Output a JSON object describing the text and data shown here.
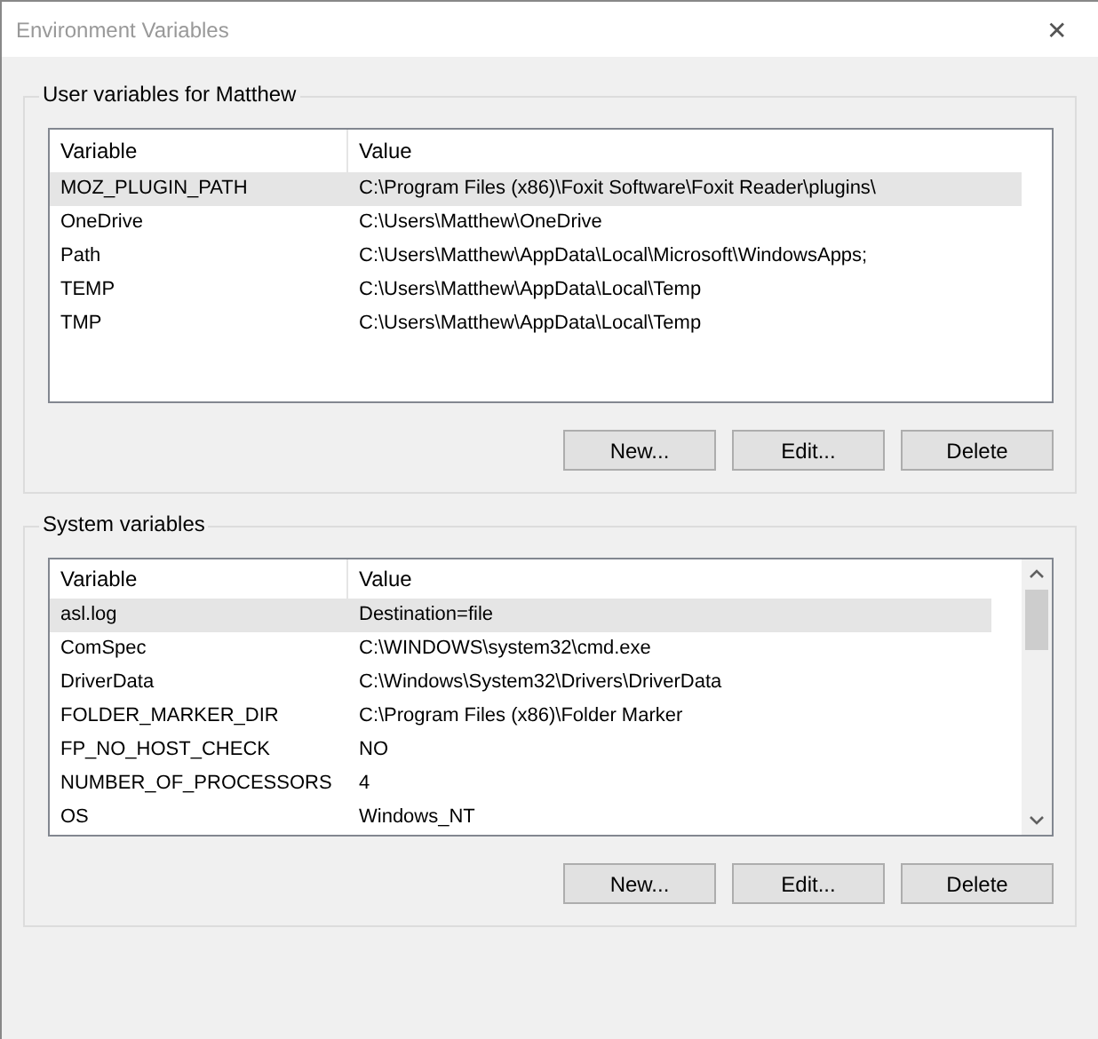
{
  "window": {
    "title": "Environment Variables",
    "close": "✕"
  },
  "groups": [
    {
      "title": "User variables for Matthew",
      "scrollable": false,
      "columns": [
        "Variable",
        "Value"
      ],
      "rows": [
        {
          "variable": "MOZ_PLUGIN_PATH",
          "value": "C:\\Program Files (x86)\\Foxit Software\\Foxit Reader\\plugins\\",
          "selected": true
        },
        {
          "variable": "OneDrive",
          "value": "C:\\Users\\Matthew\\OneDrive",
          "selected": false
        },
        {
          "variable": "Path",
          "value": "C:\\Users\\Matthew\\AppData\\Local\\Microsoft\\WindowsApps;",
          "selected": false
        },
        {
          "variable": "TEMP",
          "value": "C:\\Users\\Matthew\\AppData\\Local\\Temp",
          "selected": false
        },
        {
          "variable": "TMP",
          "value": "C:\\Users\\Matthew\\AppData\\Local\\Temp",
          "selected": false
        }
      ],
      "buttons": [
        "New...",
        "Edit...",
        "Delete"
      ]
    },
    {
      "title": "System variables",
      "scrollable": true,
      "columns": [
        "Variable",
        "Value"
      ],
      "rows": [
        {
          "variable": "asl.log",
          "value": "Destination=file",
          "selected": true
        },
        {
          "variable": "ComSpec",
          "value": "C:\\WINDOWS\\system32\\cmd.exe",
          "selected": false
        },
        {
          "variable": "DriverData",
          "value": "C:\\Windows\\System32\\Drivers\\DriverData",
          "selected": false
        },
        {
          "variable": "FOLDER_MARKER_DIR",
          "value": "C:\\Program Files (x86)\\Folder Marker",
          "selected": false
        },
        {
          "variable": "FP_NO_HOST_CHECK",
          "value": "NO",
          "selected": false
        },
        {
          "variable": "NUMBER_OF_PROCESSORS",
          "value": "4",
          "selected": false
        },
        {
          "variable": "OS",
          "value": "Windows_NT",
          "selected": false
        }
      ],
      "buttons": [
        "New...",
        "Edit...",
        "Delete"
      ]
    }
  ]
}
